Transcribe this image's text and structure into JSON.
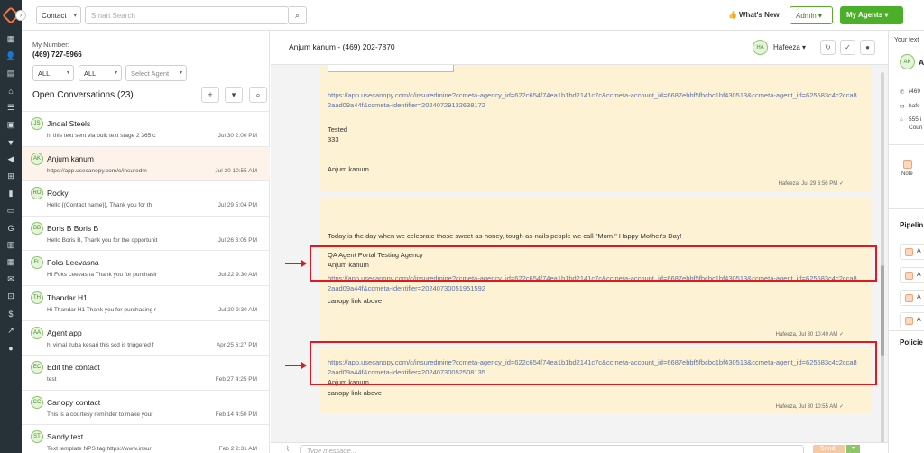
{
  "topbar": {
    "contact_select": "Contact",
    "search_placeholder": "Smart Search",
    "whats_new": "What's New",
    "admin": "Admin",
    "my_agents": "My Agents"
  },
  "conversations": {
    "my_number_label": "My Number:",
    "my_number": "(469) 727-5966",
    "filter1": "ALL",
    "filter2": "ALL",
    "agent_filter": "Select Agent",
    "open_title": "Open Conversations (23)",
    "items": [
      {
        "initials": "JS",
        "name": "Jindal Steels",
        "preview": "hi this text sent via bulk text stage 2 365 c",
        "time": "Jul 30 2:00 PM"
      },
      {
        "initials": "AK",
        "name": "Anjum kanum",
        "preview": "https://app.usecanopy.com/c/insuredm",
        "time": "Jul 30 10:55 AM"
      },
      {
        "initials": "RO",
        "name": "Rocky",
        "preview": "Hello {{Contact name}}, Thank you for th",
        "time": "Jul 29 5:04 PM"
      },
      {
        "initials": "BB",
        "name": "Boris B Boris B",
        "preview": "Hello Boris B, Thank you for the opportunit",
        "time": "Jul 26 3:05 PM"
      },
      {
        "initials": "FL",
        "name": "Foks Leevasna",
        "preview": "Hi Foks Leevasna Thank you for purchasir",
        "time": "Jul 22 9:30 AM"
      },
      {
        "initials": "TH",
        "name": "Thandar H1",
        "preview": "Hi Thandar H1 Thank you for purchasing r",
        "time": "Jul 20 9:30 AM"
      },
      {
        "initials": "AA",
        "name": "Agent app",
        "preview": "hi vimal zuba kesari this scd is triggered f",
        "time": "Apr 25 6:27 PM"
      },
      {
        "initials": "EC",
        "name": "Edit the contact",
        "preview": "test",
        "time": "Feb 27 4:25 PM"
      },
      {
        "initials": "CC",
        "name": "Canopy contact",
        "preview": "This is a courtesy reminder to make your",
        "time": "Feb 14 4:50 PM"
      },
      {
        "initials": "ST",
        "name": "Sandy text",
        "preview": "Text template NPS tag https://www.insur",
        "time": "Feb 2 2:31 AM"
      }
    ]
  },
  "chat": {
    "title": "Anjum kanum - (469) 202-7870",
    "agent_initials": "HA",
    "agent_name": "Hafeeza",
    "msg1": {
      "link": "https://app.usecanopy.com/c/insuredmine?ccmeta-agency_id=622c654f74ea1b1bd2141c7c&ccmeta-account_id=6687ebbf5fbcbc1bf430513&ccmeta-agent_id=625583c4c2cca82aad09a44f&ccmeta-identifier=20240729132638172",
      "line1": "Tested",
      "line2": "333",
      "line3": "Anjum kanum",
      "footer": "Hafeeza, Jul 29 6:56 PM"
    },
    "msg2": {
      "line1": "Today is the day when we celebrate those sweet-as-honey, tough-as-nails people we call \"Mom.\" Happy Mother's Day!",
      "line2": "QA Agent Portal Testing Agency",
      "line3": "Anjum kanum",
      "link": "https://app.usecanopy.com/c/insuredmine?ccmeta-agency_id=622c654f74ea1b1bd2141c7c&ccmeta-account_id=6687ebbf5fbcbc1bf430513&ccmeta-agent_id=625583c4c2cca82aad09a44f&ccmeta-identifier=20240730051951592",
      "line4": "canopy link above",
      "footer": "Hafeeza, Jul 30 10:49 AM"
    },
    "msg3": {
      "link": "https://app.usecanopy.com/c/insuredmine?ccmeta-agency_id=622c654f74ea1b1bd2141c7c&ccmeta-account_id=6687ebbf5fbcbc1bf430513&ccmeta-agent_id=625583c4c2cca82aad09a44f&ccmeta-identifier=20240730052508135",
      "line1": "Anjum kanum",
      "line2": "canopy link above",
      "footer": "Hafeeza, Jul 30 10:55 AM"
    },
    "compose_placeholder": "Type message...",
    "send": "Send"
  },
  "right_panel": {
    "label": "Your text",
    "initials": "AK",
    "name": "A",
    "phone": "(469",
    "email": "hafe",
    "address1": "555 i",
    "address2": "Coun",
    "note": "Note",
    "pipeline_title": "Pipelin",
    "pipeline_items": [
      "A",
      "A",
      "A",
      "A"
    ],
    "policies_title": "Policie"
  },
  "colors": {
    "brand_green": "#4caf2a",
    "rail": "#263238",
    "bubble": "#fdf3d4",
    "annotation_red": "#e0191f"
  }
}
